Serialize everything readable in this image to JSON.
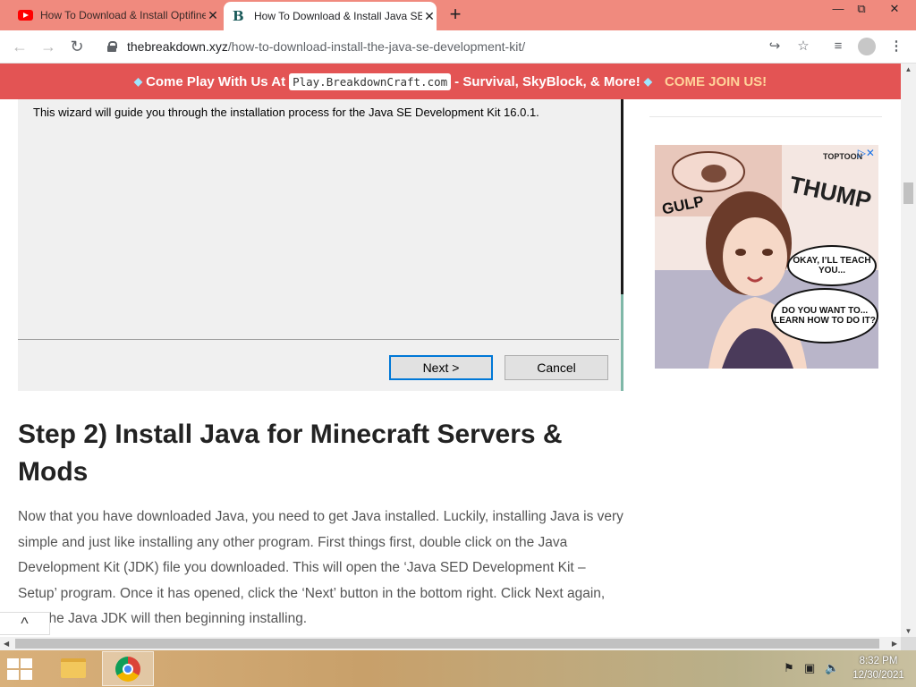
{
  "browser": {
    "tabs": [
      {
        "title": "How To Download & Install Optifine",
        "icon": "youtube-icon",
        "active": false
      },
      {
        "title": "How To Download & Install Java SE",
        "icon": "breakdown-logo-icon",
        "active": true
      }
    ],
    "new_tab_label": "+",
    "window_controls": {
      "minimize": "—",
      "maximize": "⧉",
      "close": "✕"
    },
    "url_host": "thebreakdown.xyz",
    "url_path": "/how-to-download-install-the-java-se-development-kit/",
    "toolbar_icons": [
      "share-icon",
      "star-icon",
      "media-control-icon",
      "profile-icon",
      "menu-icon"
    ]
  },
  "banner": {
    "lead": "Come Play With Us At",
    "server": "Play.BreakdownCraft.com",
    "tail": "- Survival, SkyBlock, & More!",
    "cta": "COME JOIN US!",
    "background_color": "#e35454",
    "cta_color": "#ffd49a"
  },
  "installer": {
    "text": "This wizard will guide you through the installation process for the Java SE Development Kit 16.0.1.",
    "next_label": "Next >",
    "cancel_label": "Cancel"
  },
  "article": {
    "heading": "Step 2) Install Java for Minecraft Servers & Mods",
    "paragraph": "Now that you have downloaded Java, you need to get Java installed. Luckily, installing Java is very simple and just like installing any other program. First things first, double click on the Java Development Kit (JDK) file you downloaded. This will open the ‘Java SED Development Kit – Setup’ program. Once it has opened, click the ‘Next’ button in the bottom right. Click Next again, and the Java JDK will then beginning installing."
  },
  "ad": {
    "brand": "TOPTOON",
    "gulp": "GULP",
    "thump": "THUMP",
    "bubble1": "OKAY, I’LL TEACH YOU...",
    "bubble2": "DO YOU WANT TO... LEARN HOW TO DO IT?"
  },
  "back_to_top_label": "^",
  "taskbar": {
    "time": "8:32 PM",
    "date": "12/30/2021",
    "pinned": [
      "file-explorer-icon",
      "chrome-icon"
    ]
  }
}
